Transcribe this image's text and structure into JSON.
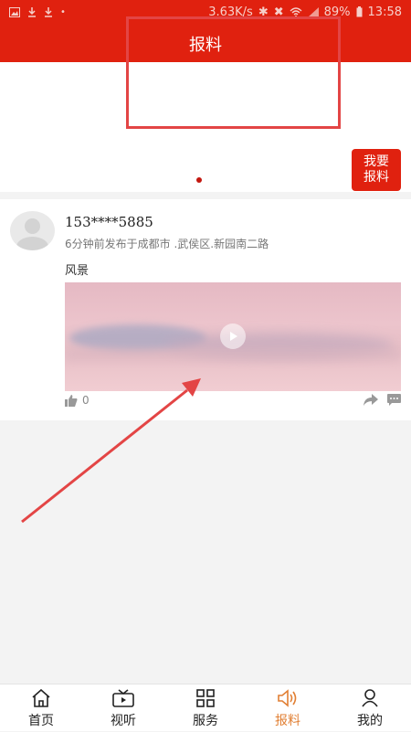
{
  "status_bar": {
    "speed": "3.63K/s",
    "battery": "89%",
    "time": "13:58"
  },
  "header": {
    "title": "报料"
  },
  "report_button": {
    "line1": "我要",
    "line2": "报料"
  },
  "post": {
    "user": "153****5885",
    "meta": "6分钟前发布于成都市 .武侯区.新园南二路",
    "text": "风景",
    "likes": "0"
  },
  "tabs": [
    {
      "label": "首页",
      "icon": "home-icon"
    },
    {
      "label": "视听",
      "icon": "video-icon"
    },
    {
      "label": "服务",
      "icon": "grid-icon"
    },
    {
      "label": "报料",
      "icon": "speaker-icon"
    },
    {
      "label": "我的",
      "icon": "person-icon"
    }
  ],
  "colors": {
    "brand": "#e0210f",
    "active_tab": "#e17f33",
    "annotation": "#e34545"
  }
}
